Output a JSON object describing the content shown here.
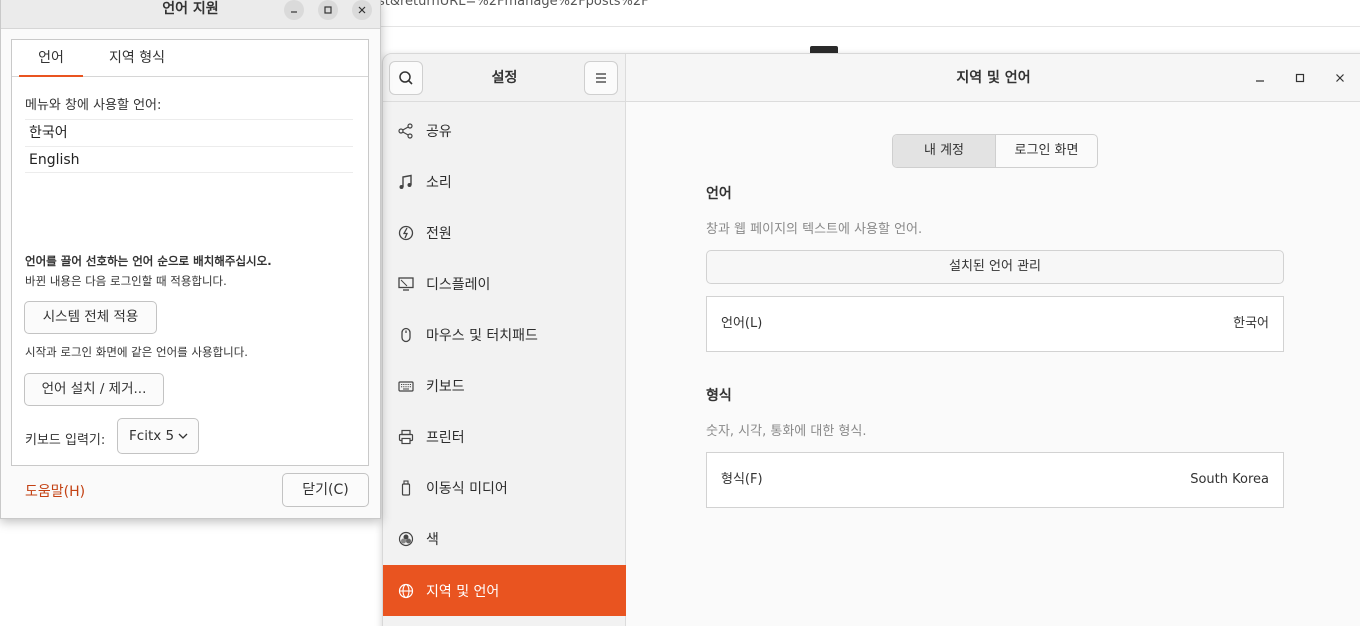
{
  "browser": {
    "url_fragment": "ost&returnURL=%2Fmanage%2Fposts%2F"
  },
  "settings": {
    "sidebar_title": "설정",
    "content_title": "지역 및 언어",
    "sidebar_items": [
      {
        "label": "공유",
        "icon": "share-icon"
      },
      {
        "label": "소리",
        "icon": "music-note-icon"
      },
      {
        "label": "전원",
        "icon": "power-icon"
      },
      {
        "label": "디스플레이",
        "icon": "display-icon"
      },
      {
        "label": "마우스 및 터치패드",
        "icon": "mouse-icon"
      },
      {
        "label": "키보드",
        "icon": "keyboard-icon"
      },
      {
        "label": "프린터",
        "icon": "printer-icon"
      },
      {
        "label": "이동식 미디어",
        "icon": "usb-media-icon"
      },
      {
        "label": "색",
        "icon": "color-icon"
      },
      {
        "label": "지역 및 언어",
        "icon": "globe-icon",
        "active": true
      }
    ],
    "segment": {
      "my_account": "내 계정",
      "login_screen": "로그인 화면"
    },
    "language_section": {
      "title": "언어",
      "description": "창과 웹 페이지의 텍스트에 사용할 언어.",
      "manage_button": "설치된 언어 관리",
      "row_label": "언어(L)",
      "row_value": "한국어"
    },
    "format_section": {
      "title": "형식",
      "description": "숫자, 시각, 통화에 대한 형식.",
      "row_label": "형식(F)",
      "row_value": "South Korea"
    },
    "accent_color": "#e95420"
  },
  "language_support": {
    "title": "언어 지원",
    "tabs": [
      "언어",
      "지역 형식"
    ],
    "languages_label": "메뉴와 창에 사용할 언어:",
    "languages": [
      "한국어",
      "English"
    ],
    "drag_hint": "언어를 끌어 선호하는 언어 순으로 배치해주십시오.",
    "next_login_hint": "바뀐 내용은 다음 로그인할 때 적용합니다.",
    "apply_system_wide": "시스템 전체 적용",
    "same_language_hint": "시작과 로그인 화면에 같은 언어를 사용합니다.",
    "install_remove": "언어 설치 / 제거...",
    "keyboard_input_label": "키보드 입력기:",
    "keyboard_input_value": "Fcitx 5",
    "help": "도움말(H)",
    "close": "닫기(C)"
  }
}
